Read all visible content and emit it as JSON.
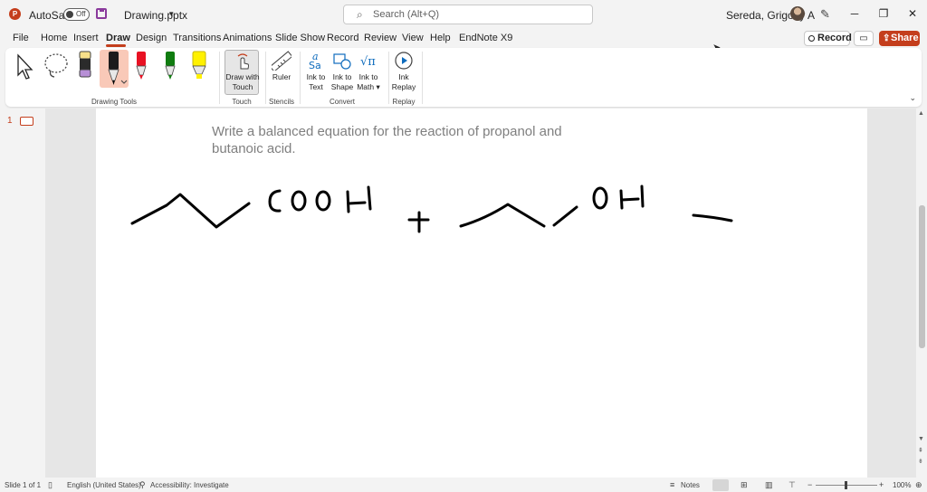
{
  "app": {
    "logo": "P",
    "autosave_label": "AutoSave",
    "autosave_state": "Off",
    "file_name": "Drawing.pptx",
    "search_placeholder": "Search (Alt+Q)",
    "user_name": "Sereda, Grigoriy A"
  },
  "tabs": [
    "File",
    "Home",
    "Insert",
    "Draw",
    "Design",
    "Transitions",
    "Animations",
    "Slide Show",
    "Record",
    "Review",
    "View",
    "Help",
    "EndNote X9"
  ],
  "active_tab": "Draw",
  "header_buttons": {
    "record": "Record",
    "share": "Share"
  },
  "ribbon": {
    "groups": {
      "drawing_tools": "Drawing Tools",
      "touch": "Touch",
      "stencils": "Stencils",
      "convert": "Convert",
      "replay": "Replay"
    },
    "buttons": {
      "draw_with_touch": "Draw with Touch",
      "ruler": "Ruler",
      "ink_to_text": "Ink to Text",
      "ink_to_shape": "Ink to Shape",
      "ink_to_math": "Ink to Math",
      "ink_replay": "Ink Replay"
    },
    "pen_colors": [
      "#000000",
      "#e81123",
      "#107c10",
      "#fff100"
    ]
  },
  "slide": {
    "number": "1",
    "text": "Write a balanced equation for the reaction of propanol and butanoic acid."
  },
  "status": {
    "slide_info": "Slide 1 of 1",
    "language": "English (United States)",
    "accessibility": "Accessibility: Investigate",
    "notes": "Notes",
    "zoom": "100%"
  }
}
